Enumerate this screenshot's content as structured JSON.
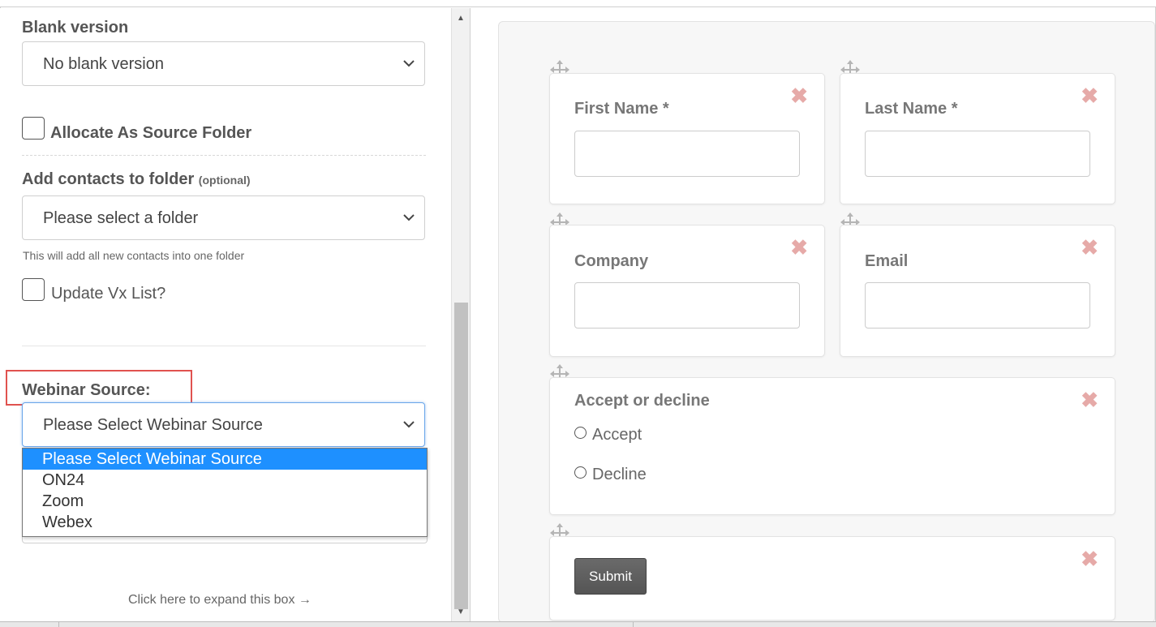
{
  "left_panel": {
    "blank_version": {
      "label": "Blank version",
      "selected": "No blank version"
    },
    "allocate_source": {
      "label": "Allocate As Source Folder",
      "checked": false
    },
    "add_contacts": {
      "label": "Add contacts to folder",
      "optional": "(optional)",
      "selected": "Please select a folder",
      "help": "This will add all new contacts into one folder"
    },
    "update_vx": {
      "label": "Update Vx List?",
      "checked": false
    },
    "webinar_source": {
      "label": "Webinar Source:",
      "selected": "Please Select Webinar Source",
      "options": [
        "Please Select Webinar Source",
        "ON24",
        "Zoom",
        "Webex"
      ]
    },
    "expand_text": "Click here to expand this box →"
  },
  "form": {
    "first_name": "First Name *",
    "last_name": "Last Name *",
    "company": "Company",
    "email": "Email",
    "accept_decline": {
      "title": "Accept or decline",
      "options": [
        "Accept",
        "Decline"
      ]
    },
    "submit": "Submit",
    "remove_glyph": "✖"
  },
  "colors": {
    "highlight_border": "#e0524f",
    "selected_option": "#1e90ff",
    "remove_icon": "#e6aaa8"
  }
}
